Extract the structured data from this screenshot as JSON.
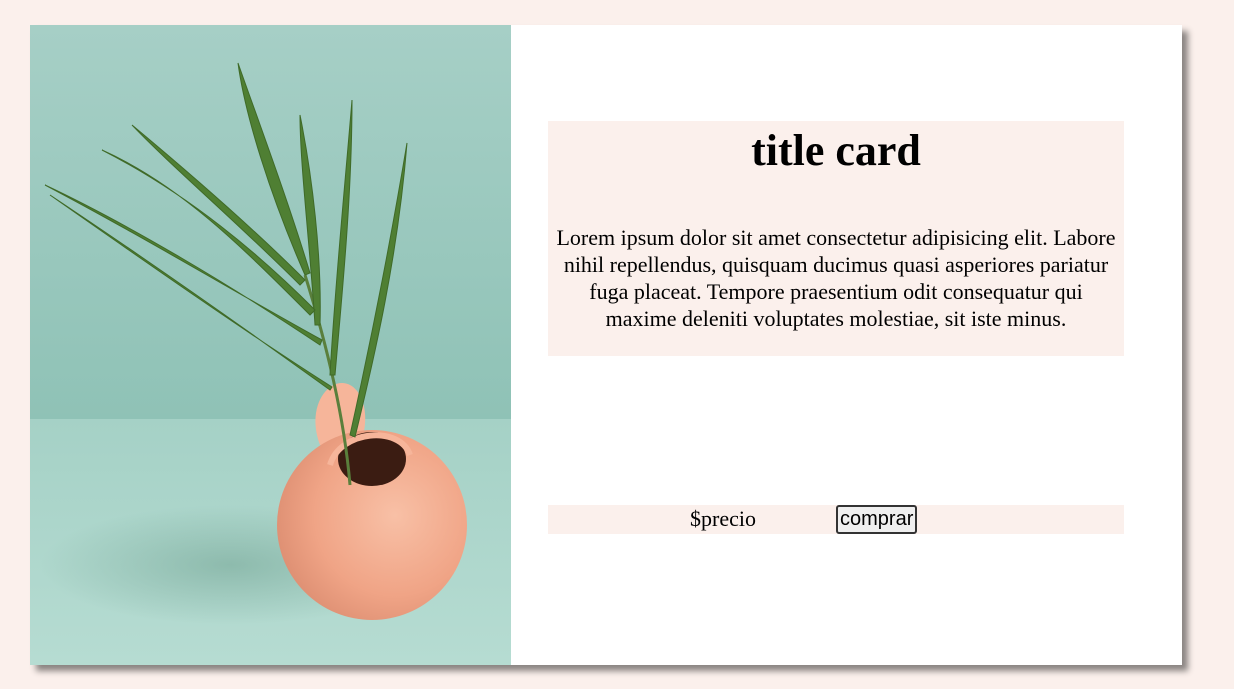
{
  "card": {
    "image_alt": "potted palm leaf in peach vase",
    "title": "title card",
    "description": "Lorem ipsum dolor sit amet consectetur adipisicing elit. Labore nihil repellendus, quisquam ducimus quasi asperiores pariatur fuga placeat. Tempore praesentium odit consequatur qui maxime deleniti voluptates molestiae, sit iste minus.",
    "price": "$precio",
    "buy_label": "comprar"
  },
  "colors": {
    "page_background": "#fbf0ec",
    "card_background": "#ffffff",
    "text_box_background": "#fbf0ec",
    "wall": "#a3cdc4",
    "table": "#aed6cd",
    "vase": "#f2a78a",
    "leaf": "#4f7f33"
  }
}
